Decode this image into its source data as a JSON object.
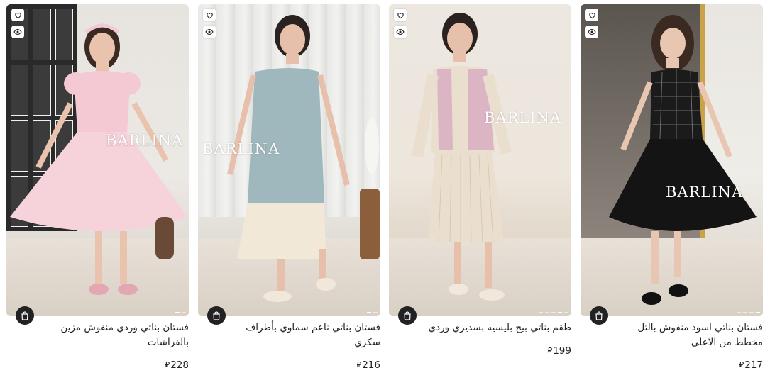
{
  "watermark": "BARLINA",
  "products": [
    {
      "title_line1": "فستان بناتي وردي منفوش مزين",
      "title_line2": "بالفراشات",
      "currency": "⃁",
      "price": "228"
    },
    {
      "title_line1": "فستان بناتي ناعم سماوي بأطراف",
      "title_line2": "سكري",
      "currency": "⃁",
      "price": "216"
    },
    {
      "title_line1": "طقم بناتي بيج بليسيه بسديري وردي",
      "title_line2": "",
      "currency": "⃁",
      "price": "199"
    },
    {
      "title_line1": "فستان بناتي اسود منفوش بالتل",
      "title_line2": "مخطط من الاعلى",
      "currency": "⃁",
      "price": "217"
    }
  ],
  "colors": {
    "pink_dress": "#f4c9d3",
    "blue_dress": "#9fb8bd",
    "beige_outfit": "#eadfcf",
    "black_dress": "#1b1b1b"
  }
}
